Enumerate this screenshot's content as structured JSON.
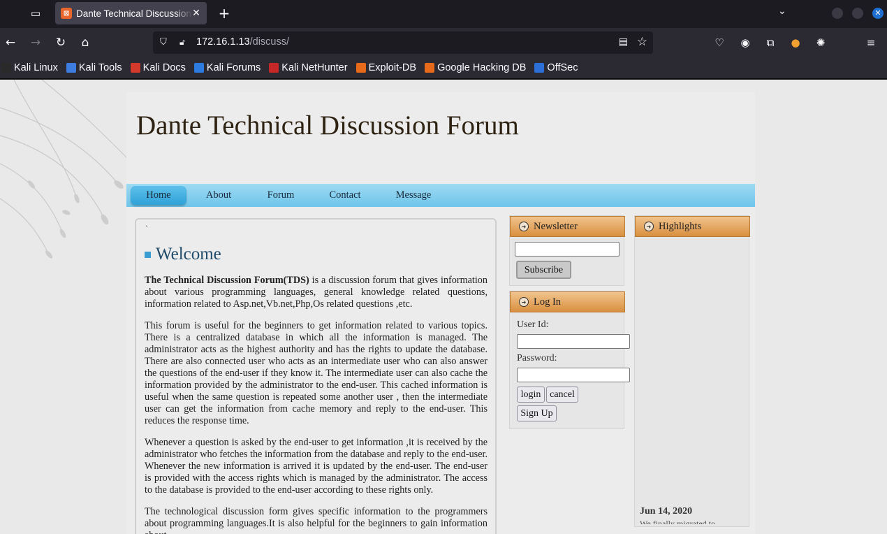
{
  "browser": {
    "tab": {
      "title": "Dante Technical Discussion Forum"
    },
    "url": {
      "host": "172.16.1.13",
      "path": "/discuss/"
    },
    "bookmarks": [
      {
        "label": "Kali Linux",
        "icon": "kali-dragon-icon",
        "color": "#2a2a2a"
      },
      {
        "label": "Kali Tools",
        "icon": "kali-tools-icon",
        "color": "#3d7de0"
      },
      {
        "label": "Kali Docs",
        "icon": "kali-docs-icon",
        "color": "#d33a2c"
      },
      {
        "label": "Kali Forums",
        "icon": "kali-forums-icon",
        "color": "#2e7be0"
      },
      {
        "label": "Kali NetHunter",
        "icon": "nethunter-icon",
        "color": "#c62828"
      },
      {
        "label": "Exploit-DB",
        "icon": "exploit-db-icon",
        "color": "#e66a1a"
      },
      {
        "label": "Google Hacking DB",
        "icon": "ghdb-icon",
        "color": "#e66a1a"
      },
      {
        "label": "OffSec",
        "icon": "offsec-icon",
        "color": "#2c6fd6"
      }
    ]
  },
  "site": {
    "title": "Dante Technical Discussion Forum",
    "menu": [
      "Home",
      "About",
      "Forum",
      "Contact",
      "Message"
    ],
    "active_menu": "Home"
  },
  "main": {
    "tick": "`",
    "heading": "Welcome",
    "intro_bold": "The Technical Discussion Forum(TDS)",
    "intro_rest": " is a discussion forum that gives information about various programming languages, general knowledge related questions, information related to Asp.net,Vb.net,Php,Os related questions ,etc.",
    "para2": "This forum is useful for the beginners to get information related to various topics. There is a centralized database in which all the information is managed. The administrator acts as the highest authority and has the rights to update the database. There are also connected user who acts as an intermediate user who can also answer the questions of the end-user if they know it. The intermediate user can also cache the information provided by the administrator to the end-user. This cached information is useful when the same question is repeated some another user , then the intermediate user can get the information from cache memory and reply to the end-user. This reduces the response time.",
    "para3": "Whenever a question is asked by the end-user to get information ,it is received by the administrator who fetches the information from the database and reply to the end-user. Whenever the new information is arrived it is updated by the end-user. The end-user is provided with the access rights which is managed by the administrator. The access to the database is provided to the end-user according to these rights only.",
    "para4": "The technological discussion form gives specific information to the programmers about programming languages.It is also helpful for the beginners to gain information about"
  },
  "newsletter": {
    "heading": "Newsletter",
    "email_value": "",
    "subscribe_label": "Subscribe"
  },
  "login": {
    "heading": "Log In",
    "userid_label": "User Id:",
    "password_label": "Password:",
    "login_label": "login",
    "cancel_label": "cancel",
    "signup_label": "Sign Up"
  },
  "highlights": {
    "heading": "Highlights",
    "date": "Jun 14, 2020",
    "snippet": "We finally migrated to"
  }
}
